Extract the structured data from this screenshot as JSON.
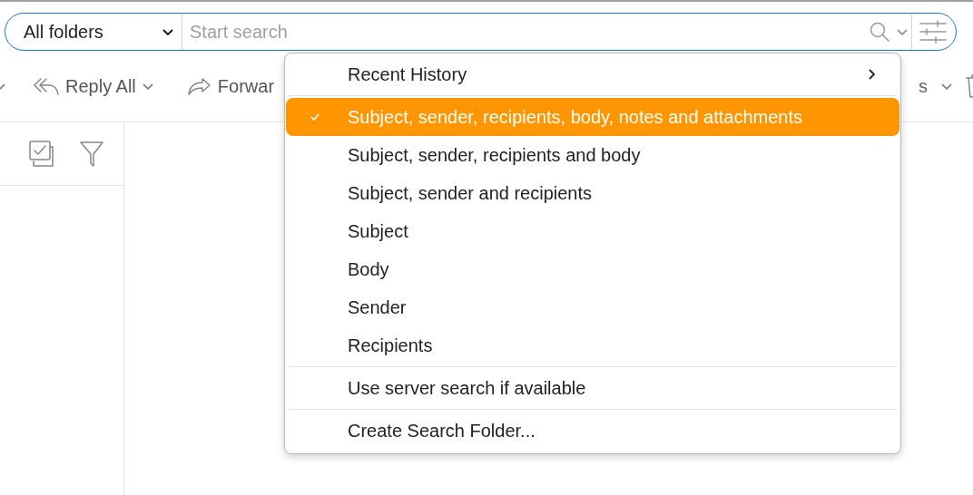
{
  "search_bar": {
    "folder_scope": "All folders",
    "placeholder": "Start search"
  },
  "toolbar": {
    "left_items": [
      {
        "label": "Reply All",
        "kind": "reply-all"
      },
      {
        "label": "Forwar",
        "kind": "forward"
      }
    ],
    "right_label": "s"
  },
  "menu": {
    "items": [
      {
        "kind": "submenu",
        "label": "Recent History"
      },
      {
        "kind": "separator"
      },
      {
        "kind": "option",
        "label": "Subject, sender, recipients, body, notes and attachments",
        "selected": true
      },
      {
        "kind": "option",
        "label": "Subject, sender, recipients and body",
        "selected": false
      },
      {
        "kind": "option",
        "label": "Subject, sender and recipients",
        "selected": false
      },
      {
        "kind": "option",
        "label": "Subject",
        "selected": false
      },
      {
        "kind": "option",
        "label": "Body",
        "selected": false
      },
      {
        "kind": "option",
        "label": "Sender",
        "selected": false
      },
      {
        "kind": "option",
        "label": "Recipients",
        "selected": false
      },
      {
        "kind": "separator"
      },
      {
        "kind": "toggle",
        "label": "Use server search if available",
        "checked": false
      },
      {
        "kind": "separator"
      },
      {
        "kind": "action",
        "label": "Create Search Folder..."
      }
    ]
  }
}
